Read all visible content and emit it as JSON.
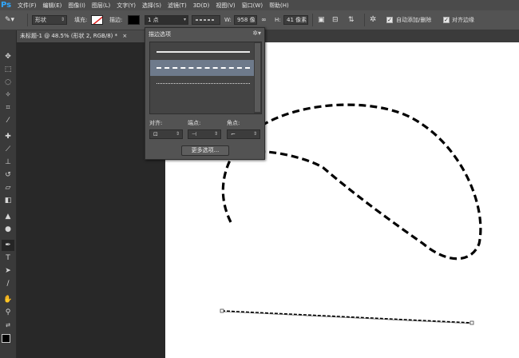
{
  "app": {
    "logo": "Ps"
  },
  "menu": [
    "文件(F)",
    "编辑(E)",
    "图像(I)",
    "图层(L)",
    "文字(Y)",
    "选择(S)",
    "滤镜(T)",
    "3D(D)",
    "视图(V)",
    "窗口(W)",
    "帮助(H)"
  ],
  "options": {
    "mode_value": "形状",
    "fill_label": "填充:",
    "stroke_label": "描边:",
    "stroke_width_value": "1 点",
    "w_label": "W:",
    "w_value": "958 像",
    "h_label": "H:",
    "h_value": "41 像素",
    "auto_add_label": "自动添加/删除",
    "align_edges_label": "对齐边缘"
  },
  "tab": {
    "title": "未标题-1 @ 48.5% (形状 2, RGB/8) *",
    "close": "×"
  },
  "popup": {
    "title": "描边选项",
    "align_label": "对齐:",
    "caps_label": "端点:",
    "corners_label": "角点:",
    "more_button": "更多选项..."
  },
  "tools": [
    "move-icon",
    "marquee-icon",
    "lasso-icon",
    "quick-select-icon",
    "crop-icon",
    "eyedropper-icon",
    "healing-icon",
    "brush-icon",
    "stamp-icon",
    "history-brush-icon",
    "eraser-icon",
    "gradient-icon",
    "dodge-icon",
    "pen-icon",
    "type-icon",
    "path-select-icon",
    "line-shape-icon",
    "hand-icon",
    "zoom-icon"
  ],
  "colors": {
    "accent": "#31a8ff",
    "selected_preset": "#6e7a8b",
    "panel": "#535353"
  }
}
